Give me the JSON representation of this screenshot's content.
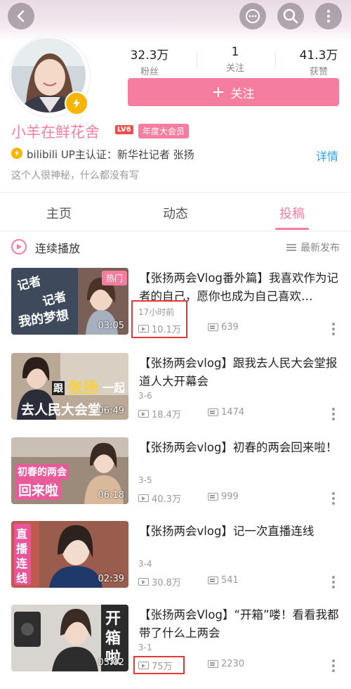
{
  "header": {
    "back_icon": "back-arrow-icon",
    "message_icon": "message-icon",
    "search_icon": "search-icon",
    "more_icon": "more-vertical-icon"
  },
  "profile": {
    "stats": [
      {
        "value": "32.3万",
        "label": "粉丝"
      },
      {
        "value": "1",
        "label": "关注"
      },
      {
        "value": "41.3万",
        "label": "获赞"
      }
    ],
    "follow_label": "关注",
    "name": "小羊在鲜花舍",
    "level_badge": "LV6",
    "vip_badge": "年度大会员",
    "certification": "bilibili UP主认证：新华社记者 张扬",
    "detail_link": "详情",
    "bio": "这个人很神秘，什么都没有写"
  },
  "tabs": [
    {
      "label": "主页",
      "active": false
    },
    {
      "label": "动态",
      "active": false
    },
    {
      "label": "投稿",
      "active": true
    }
  ],
  "playlist": {
    "continuous_play": "连续播放",
    "sort_label": "最新发布"
  },
  "videos": [
    {
      "title": "【张扬两会Vlog番外篇】我喜欢作为记者的自己，愿你也成为自己喜欢…",
      "date": "17小时前",
      "plays": "10.1万",
      "comments": "639",
      "duration": "03:05",
      "hot_badge": "热门",
      "thumb_text": [
        "记者",
        "记者",
        "我的梦想"
      ]
    },
    {
      "title": "【张扬两会vlog】跟我去人民大会堂报道人大开幕会",
      "date": "3-6",
      "plays": "18.4万",
      "comments": "1474",
      "duration": "06:49",
      "thumb_text": [
        "跟",
        "张扬",
        "一起",
        "去人民大会堂"
      ]
    },
    {
      "title": "【张扬两会vlog】初春的两会回来啦！",
      "date": "3-5",
      "plays": "40.3万",
      "comments": "999",
      "duration": "06:18",
      "thumb_text": [
        "初春的两会",
        "回来啦"
      ]
    },
    {
      "title": "【张扬两会vlog】记一次直播连线",
      "date": "3-4",
      "plays": "30.8万",
      "comments": "541",
      "duration": "02:39",
      "thumb_text": [
        "直",
        "播",
        "连",
        "线"
      ]
    },
    {
      "title": "【张扬两会Vlog】“开箱”喽！看看我都带了什么上两会",
      "date": "3-1",
      "plays": "75万",
      "comments": "2230",
      "duration": "05:02",
      "thumb_text": [
        "开",
        "箱",
        "啦"
      ]
    }
  ],
  "colors": {
    "accent": "#f57ea0",
    "link": "#2e9fe3",
    "highlight_box": "#e53935"
  }
}
